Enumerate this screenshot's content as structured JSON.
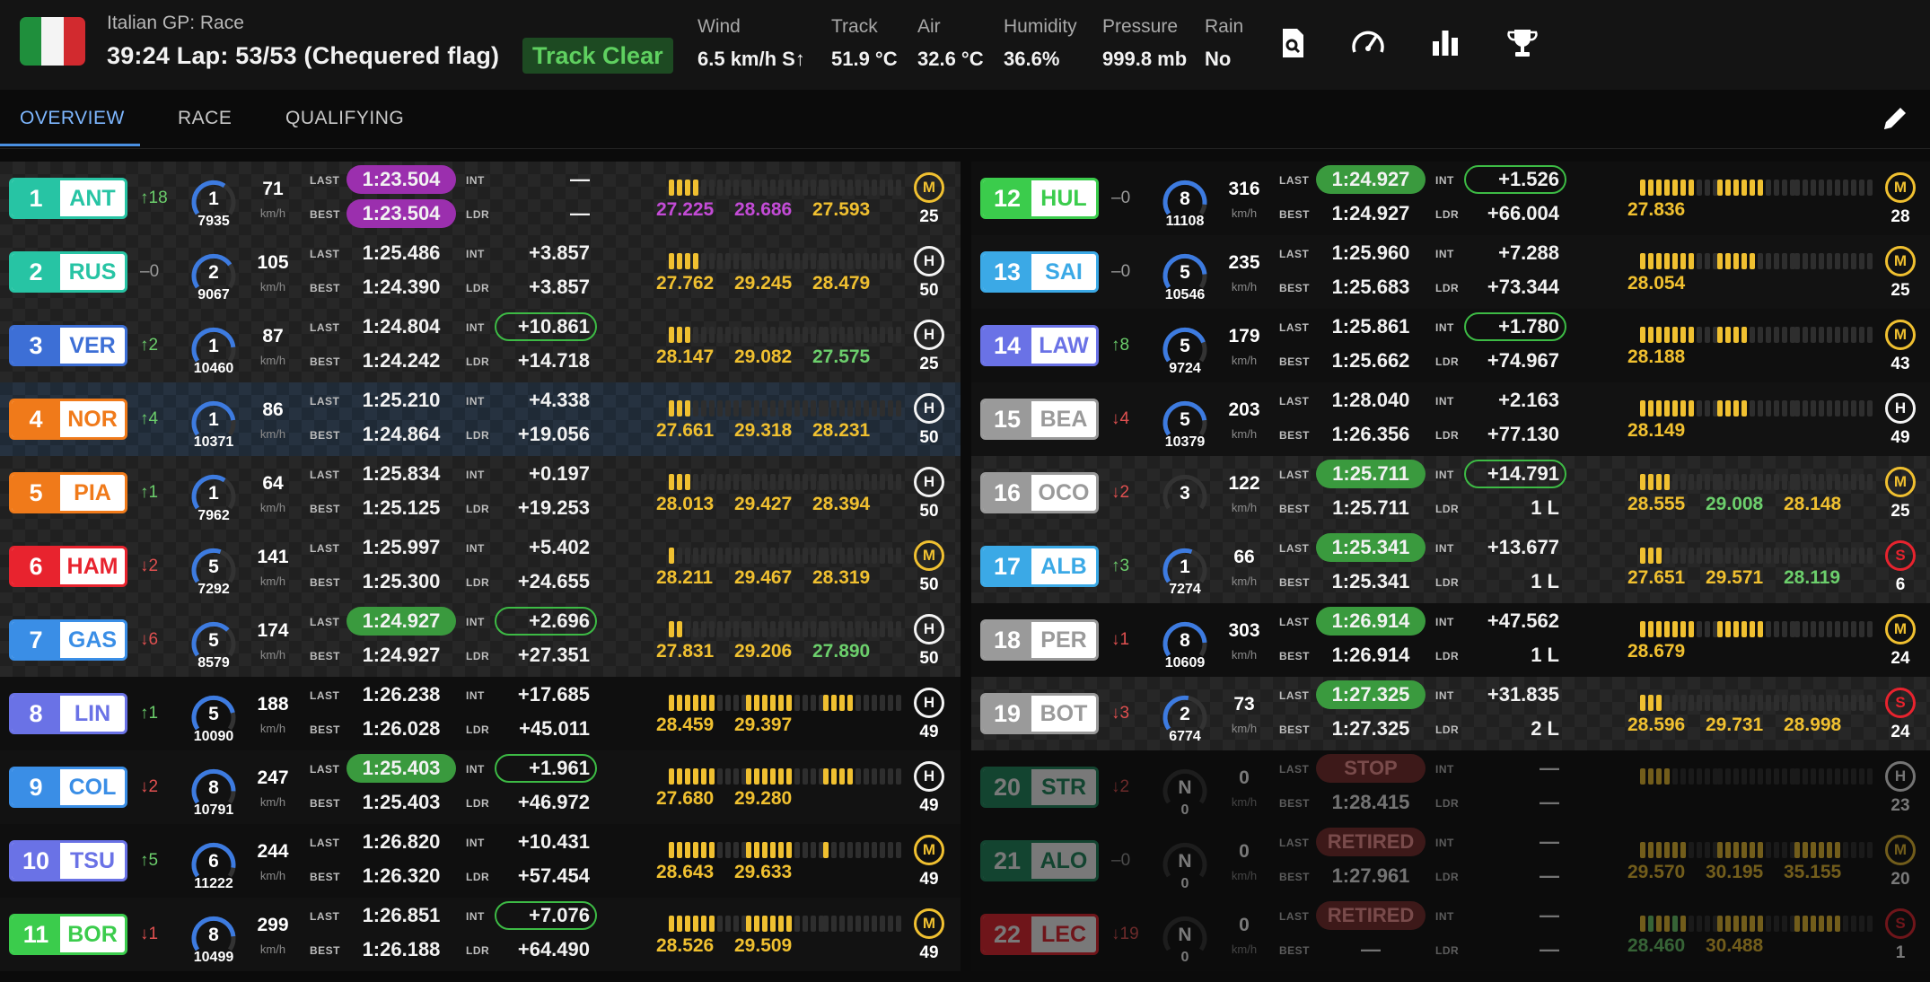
{
  "header": {
    "session": "Italian GP: Race",
    "status": "39:24 Lap: 53/53 (Chequered flag)",
    "track_status": "Track Clear",
    "weather": [
      {
        "label": "Wind",
        "value": "6.5 km/h S↑"
      },
      {
        "label": "Track",
        "value": "51.9 °C"
      },
      {
        "label": "Air",
        "value": "32.6 °C"
      },
      {
        "label": "Humidity",
        "value": "36.6%"
      },
      {
        "label": "Pressure",
        "value": "999.8 mb"
      },
      {
        "label": "Rain",
        "value": "No"
      }
    ],
    "tools": [
      "search-document-icon",
      "speedometer-icon",
      "bar-chart-icon",
      "trophy-icon"
    ]
  },
  "tabs": [
    "OVERVIEW",
    "RACE",
    "QUALIFYING"
  ],
  "labels": {
    "last": "LAST",
    "best": "BEST",
    "int": "INT",
    "ldr": "LDR",
    "kmh": "km/h"
  },
  "colors": {
    "mercedes": "#27c4a4",
    "redbull": "#3d6fd6",
    "mclaren": "#f07a1a",
    "ferrari": "#e8232e",
    "alpine": "#3a8ee6",
    "williams": "#3ba9e6",
    "rb": "#6a72e6",
    "sauber": "#3bcc4c",
    "haas": "#9a9a9a",
    "aston": "#1d8a5e",
    "purple": "#c34bd6",
    "green": "#6ccf6c",
    "yellow": "#f0c030"
  },
  "drivers": [
    {
      "pos": "1",
      "code": "ANT",
      "team": "mercedes",
      "chg": "↑18",
      "dir": "up",
      "gear": "1",
      "rpm": "7935",
      "speed": "71",
      "last": "1:23.504",
      "last_style": "purple",
      "best": "1:23.504",
      "best_style": "purple",
      "int": "—",
      "int_style": "",
      "ldr": "—",
      "s": [
        "27.225",
        "28.686",
        "27.593"
      ],
      "sc": [
        "purple",
        "purple",
        "yellow"
      ],
      "mini": [
        4,
        0,
        0
      ],
      "tyre": "M",
      "laps": "25",
      "bg": "chk"
    },
    {
      "pos": "2",
      "code": "RUS",
      "team": "mercedes",
      "chg": "–0",
      "dir": "eq",
      "gear": "2",
      "rpm": "9067",
      "speed": "105",
      "last": "1:25.486",
      "last_style": "",
      "best": "1:24.390",
      "best_style": "",
      "int": "+3.857",
      "int_style": "",
      "ldr": "+3.857",
      "s": [
        "27.762",
        "29.245",
        "28.479"
      ],
      "sc": [
        "yellow",
        "yellow",
        "yellow"
      ],
      "mini": [
        4,
        0,
        0
      ],
      "tyre": "H",
      "laps": "50",
      "bg": "chk"
    },
    {
      "pos": "3",
      "code": "VER",
      "team": "redbull",
      "chg": "↑2",
      "dir": "up",
      "gear": "1",
      "rpm": "10460",
      "speed": "87",
      "last": "1:24.804",
      "last_style": "",
      "best": "1:24.242",
      "best_style": "",
      "int": "+10.861",
      "int_style": "outl",
      "ldr": "+14.718",
      "s": [
        "28.147",
        "29.082",
        "27.575"
      ],
      "sc": [
        "yellow",
        "yellow",
        "green"
      ],
      "mini": [
        3,
        0,
        0
      ],
      "tyre": "H",
      "laps": "25",
      "bg": "chk"
    },
    {
      "pos": "4",
      "code": "NOR",
      "team": "mclaren",
      "chg": "↑4",
      "dir": "up",
      "gear": "1",
      "rpm": "10371",
      "speed": "86",
      "last": "1:25.210",
      "last_style": "",
      "best": "1:24.864",
      "best_style": "",
      "int": "+4.338",
      "int_style": "",
      "ldr": "+19.056",
      "s": [
        "27.661",
        "29.318",
        "28.231"
      ],
      "sc": [
        "yellow",
        "yellow",
        "yellow"
      ],
      "mini": [
        3,
        0,
        0
      ],
      "tyre": "H",
      "laps": "50",
      "bg": "hl"
    },
    {
      "pos": "5",
      "code": "PIA",
      "team": "mclaren",
      "chg": "↑1",
      "dir": "up",
      "gear": "1",
      "rpm": "7962",
      "speed": "64",
      "last": "1:25.834",
      "last_style": "",
      "best": "1:25.125",
      "best_style": "",
      "int": "+0.197",
      "int_style": "",
      "ldr": "+19.253",
      "s": [
        "28.013",
        "29.427",
        "28.394"
      ],
      "sc": [
        "yellow",
        "yellow",
        "yellow"
      ],
      "mini": [
        3,
        0,
        0
      ],
      "tyre": "H",
      "laps": "50",
      "bg": "chk"
    },
    {
      "pos": "6",
      "code": "HAM",
      "team": "ferrari",
      "chg": "↓2",
      "dir": "down",
      "gear": "5",
      "rpm": "7292",
      "speed": "141",
      "last": "1:25.997",
      "last_style": "",
      "best": "1:25.300",
      "best_style": "",
      "int": "+5.402",
      "int_style": "",
      "ldr": "+24.655",
      "s": [
        "28.211",
        "29.467",
        "28.319"
      ],
      "sc": [
        "yellow",
        "yellow",
        "yellow"
      ],
      "mini": [
        1,
        0,
        0
      ],
      "tyre": "M",
      "laps": "50",
      "bg": "chk"
    },
    {
      "pos": "7",
      "code": "GAS",
      "team": "alpine",
      "chg": "↓6",
      "dir": "down",
      "gear": "5",
      "rpm": "8579",
      "speed": "174",
      "last": "1:24.927",
      "last_style": "green",
      "best": "1:24.927",
      "best_style": "",
      "int": "+2.696",
      "int_style": "outl",
      "ldr": "+27.351",
      "s": [
        "27.831",
        "29.206",
        "27.890"
      ],
      "sc": [
        "yellow",
        "yellow",
        "green"
      ],
      "mini": [
        2,
        0,
        0
      ],
      "tyre": "H",
      "laps": "50",
      "bg": "chk"
    },
    {
      "pos": "8",
      "code": "LIN",
      "team": "rb",
      "chg": "↑1",
      "dir": "up",
      "gear": "5",
      "rpm": "10090",
      "speed": "188",
      "last": "1:26.238",
      "last_style": "",
      "best": "1:26.028",
      "best_style": "",
      "int": "+17.685",
      "int_style": "",
      "ldr": "+45.011",
      "s": [
        "28.459",
        "29.397",
        ""
      ],
      "sc": [
        "yellow",
        "yellow",
        "yellow"
      ],
      "mini": [
        6,
        6,
        4
      ],
      "tyre": "H",
      "laps": "49",
      "bg": "dark"
    },
    {
      "pos": "9",
      "code": "COL",
      "team": "alpine",
      "chg": "↓2",
      "dir": "down",
      "gear": "8",
      "rpm": "10791",
      "speed": "247",
      "last": "1:25.403",
      "last_style": "green",
      "best": "1:25.403",
      "best_style": "",
      "int": "+1.961",
      "int_style": "outl",
      "ldr": "+46.972",
      "s": [
        "27.680",
        "29.280",
        ""
      ],
      "sc": [
        "yellow",
        "yellow",
        "yellow"
      ],
      "mini": [
        6,
        6,
        4
      ],
      "tyre": "H",
      "laps": "49",
      "bg": "alt"
    },
    {
      "pos": "10",
      "code": "TSU",
      "team": "rb",
      "chg": "↑5",
      "dir": "up",
      "gear": "6",
      "rpm": "11222",
      "speed": "244",
      "last": "1:26.820",
      "last_style": "",
      "best": "1:26.320",
      "best_style": "",
      "int": "+10.431",
      "int_style": "",
      "ldr": "+57.454",
      "s": [
        "28.643",
        "29.633",
        ""
      ],
      "sc": [
        "yellow",
        "yellow",
        "yellow"
      ],
      "mini": [
        6,
        6,
        1
      ],
      "tyre": "M",
      "laps": "49",
      "bg": "dark"
    },
    {
      "pos": "11",
      "code": "BOR",
      "team": "sauber",
      "chg": "↓1",
      "dir": "down",
      "gear": "8",
      "rpm": "10499",
      "speed": "299",
      "last": "1:26.851",
      "last_style": "",
      "best": "1:26.188",
      "best_style": "",
      "int": "+7.076",
      "int_style": "outl",
      "ldr": "+64.490",
      "s": [
        "28.526",
        "29.509",
        ""
      ],
      "sc": [
        "yellow",
        "yellow",
        "yellow"
      ],
      "mini": [
        6,
        6,
        0
      ],
      "tyre": "M",
      "laps": "49",
      "bg": "alt"
    },
    {
      "pos": "12",
      "code": "HUL",
      "team": "sauber",
      "chg": "–0",
      "dir": "eq",
      "gear": "8",
      "rpm": "11108",
      "speed": "316",
      "last": "1:24.927",
      "last_style": "green",
      "best": "1:24.927",
      "best_style": "",
      "int": "+1.526",
      "int_style": "outl",
      "ldr": "+66.004",
      "s": [
        "27.836",
        "",
        ""
      ],
      "sc": [
        "yellow",
        "yellow",
        "yellow"
      ],
      "mini": [
        7,
        6,
        0
      ],
      "tyre": "M",
      "laps": "28",
      "bg": "dark"
    },
    {
      "pos": "13",
      "code": "SAI",
      "team": "williams",
      "chg": "–0",
      "dir": "eq",
      "gear": "5",
      "rpm": "10546",
      "speed": "235",
      "last": "1:25.960",
      "last_style": "",
      "best": "1:25.683",
      "best_style": "",
      "int": "+7.288",
      "int_style": "",
      "ldr": "+73.344",
      "s": [
        "28.054",
        "",
        ""
      ],
      "sc": [
        "yellow",
        "yellow",
        "yellow"
      ],
      "mini": [
        7,
        5,
        0
      ],
      "tyre": "M",
      "laps": "25",
      "bg": "alt"
    },
    {
      "pos": "14",
      "code": "LAW",
      "team": "rb",
      "chg": "↑8",
      "dir": "up",
      "gear": "5",
      "rpm": "9724",
      "speed": "179",
      "last": "1:25.861",
      "last_style": "",
      "best": "1:25.662",
      "best_style": "",
      "int": "+1.780",
      "int_style": "outl",
      "ldr": "+74.967",
      "s": [
        "28.188",
        "",
        ""
      ],
      "sc": [
        "yellow",
        "yellow",
        "yellow"
      ],
      "mini": [
        7,
        4,
        0
      ],
      "tyre": "M",
      "laps": "43",
      "bg": "dark"
    },
    {
      "pos": "15",
      "code": "BEA",
      "team": "haas",
      "chg": "↓4",
      "dir": "down",
      "gear": "5",
      "rpm": "10379",
      "speed": "203",
      "last": "1:28.040",
      "last_style": "",
      "best": "1:26.356",
      "best_style": "",
      "int": "+2.163",
      "int_style": "",
      "ldr": "+77.130",
      "s": [
        "28.149",
        "",
        ""
      ],
      "sc": [
        "yellow",
        "yellow",
        "yellow"
      ],
      "mini": [
        7,
        4,
        0
      ],
      "tyre": "H",
      "laps": "49",
      "bg": "alt"
    },
    {
      "pos": "16",
      "code": "OCO",
      "team": "haas",
      "chg": "↓2",
      "dir": "down",
      "gear": "3",
      "rpm": "",
      "speed": "122",
      "last": "1:25.711",
      "last_style": "green",
      "best": "1:25.711",
      "best_style": "",
      "int": "+14.791",
      "int_style": "outl",
      "ldr": "1 L",
      "s": [
        "28.555",
        "29.008",
        "28.148"
      ],
      "sc": [
        "yellow",
        "green",
        "yellow"
      ],
      "mini": [
        4,
        0,
        0
      ],
      "tyre": "M",
      "laps": "25",
      "bg": "chk"
    },
    {
      "pos": "17",
      "code": "ALB",
      "team": "williams",
      "chg": "↑3",
      "dir": "up",
      "gear": "1",
      "rpm": "7274",
      "speed": "66",
      "last": "1:25.341",
      "last_style": "green",
      "best": "1:25.341",
      "best_style": "",
      "int": "+13.677",
      "int_style": "",
      "ldr": "1 L",
      "s": [
        "27.651",
        "29.571",
        "28.119"
      ],
      "sc": [
        "yellow",
        "yellow",
        "green"
      ],
      "mini": [
        3,
        0,
        0
      ],
      "tyre": "S",
      "laps": "6",
      "bg": "chk"
    },
    {
      "pos": "18",
      "code": "PER",
      "team": "haas",
      "chg": "↓1",
      "dir": "down",
      "gear": "8",
      "rpm": "10609",
      "speed": "303",
      "last": "1:26.914",
      "last_style": "green",
      "best": "1:26.914",
      "best_style": "",
      "int": "+47.562",
      "int_style": "",
      "ldr": "1 L",
      "s": [
        "28.679",
        "",
        ""
      ],
      "sc": [
        "yellow",
        "yellow",
        "yellow"
      ],
      "mini": [
        7,
        6,
        0
      ],
      "tyre": "M",
      "laps": "24",
      "bg": "dark"
    },
    {
      "pos": "19",
      "code": "BOT",
      "team": "haas",
      "chg": "↓3",
      "dir": "down",
      "gear": "2",
      "rpm": "6774",
      "speed": "73",
      "last": "1:27.325",
      "last_style": "green",
      "best": "1:27.325",
      "best_style": "",
      "int": "+31.835",
      "int_style": "",
      "ldr": "2 L",
      "s": [
        "28.596",
        "29.731",
        "28.998"
      ],
      "sc": [
        "yellow",
        "yellow",
        "yellow"
      ],
      "mini": [
        3,
        0,
        0
      ],
      "tyre": "S",
      "laps": "24",
      "bg": "chk"
    },
    {
      "pos": "20",
      "code": "STR",
      "team": "aston",
      "chg": "↓2",
      "dir": "down",
      "gear": "N",
      "rpm": "0",
      "speed": "0",
      "last": "STOP",
      "last_style": "red",
      "best": "1:28.415",
      "best_style": "",
      "int": "—",
      "int_style": "",
      "ldr": "—",
      "s": [
        "",
        "",
        ""
      ],
      "sc": [
        "yellow",
        "yellow",
        "yellow"
      ],
      "mini": [
        4,
        0,
        0
      ],
      "tyre": "H",
      "laps": "23",
      "bg": "out"
    },
    {
      "pos": "21",
      "code": "ALO",
      "team": "aston",
      "chg": "–0",
      "dir": "eq",
      "gear": "N",
      "rpm": "0",
      "speed": "0",
      "last": "RETIRED",
      "last_style": "red",
      "best": "1:27.961",
      "best_style": "",
      "int": "—",
      "int_style": "",
      "ldr": "—",
      "s": [
        "29.570",
        "30.195",
        "35.155"
      ],
      "sc": [
        "yellow",
        "yellow",
        "yellow"
      ],
      "mini": [
        6,
        6,
        6
      ],
      "tyre": "M",
      "laps": "20",
      "bg": "out"
    },
    {
      "pos": "22",
      "code": "LEC",
      "team": "ferrari",
      "chg": "↓19",
      "dir": "down",
      "gear": "N",
      "rpm": "0",
      "speed": "0",
      "last": "RETIRED",
      "last_style": "red",
      "best": "—",
      "best_style": "",
      "int": "—",
      "int_style": "",
      "ldr": "—",
      "s": [
        "28.460",
        "30.488",
        ""
      ],
      "sc": [
        "green",
        "yellow",
        "yellow"
      ],
      "mini": [
        6,
        6,
        6
      ],
      "tyre": "S",
      "laps": "1",
      "bg": "out"
    }
  ]
}
